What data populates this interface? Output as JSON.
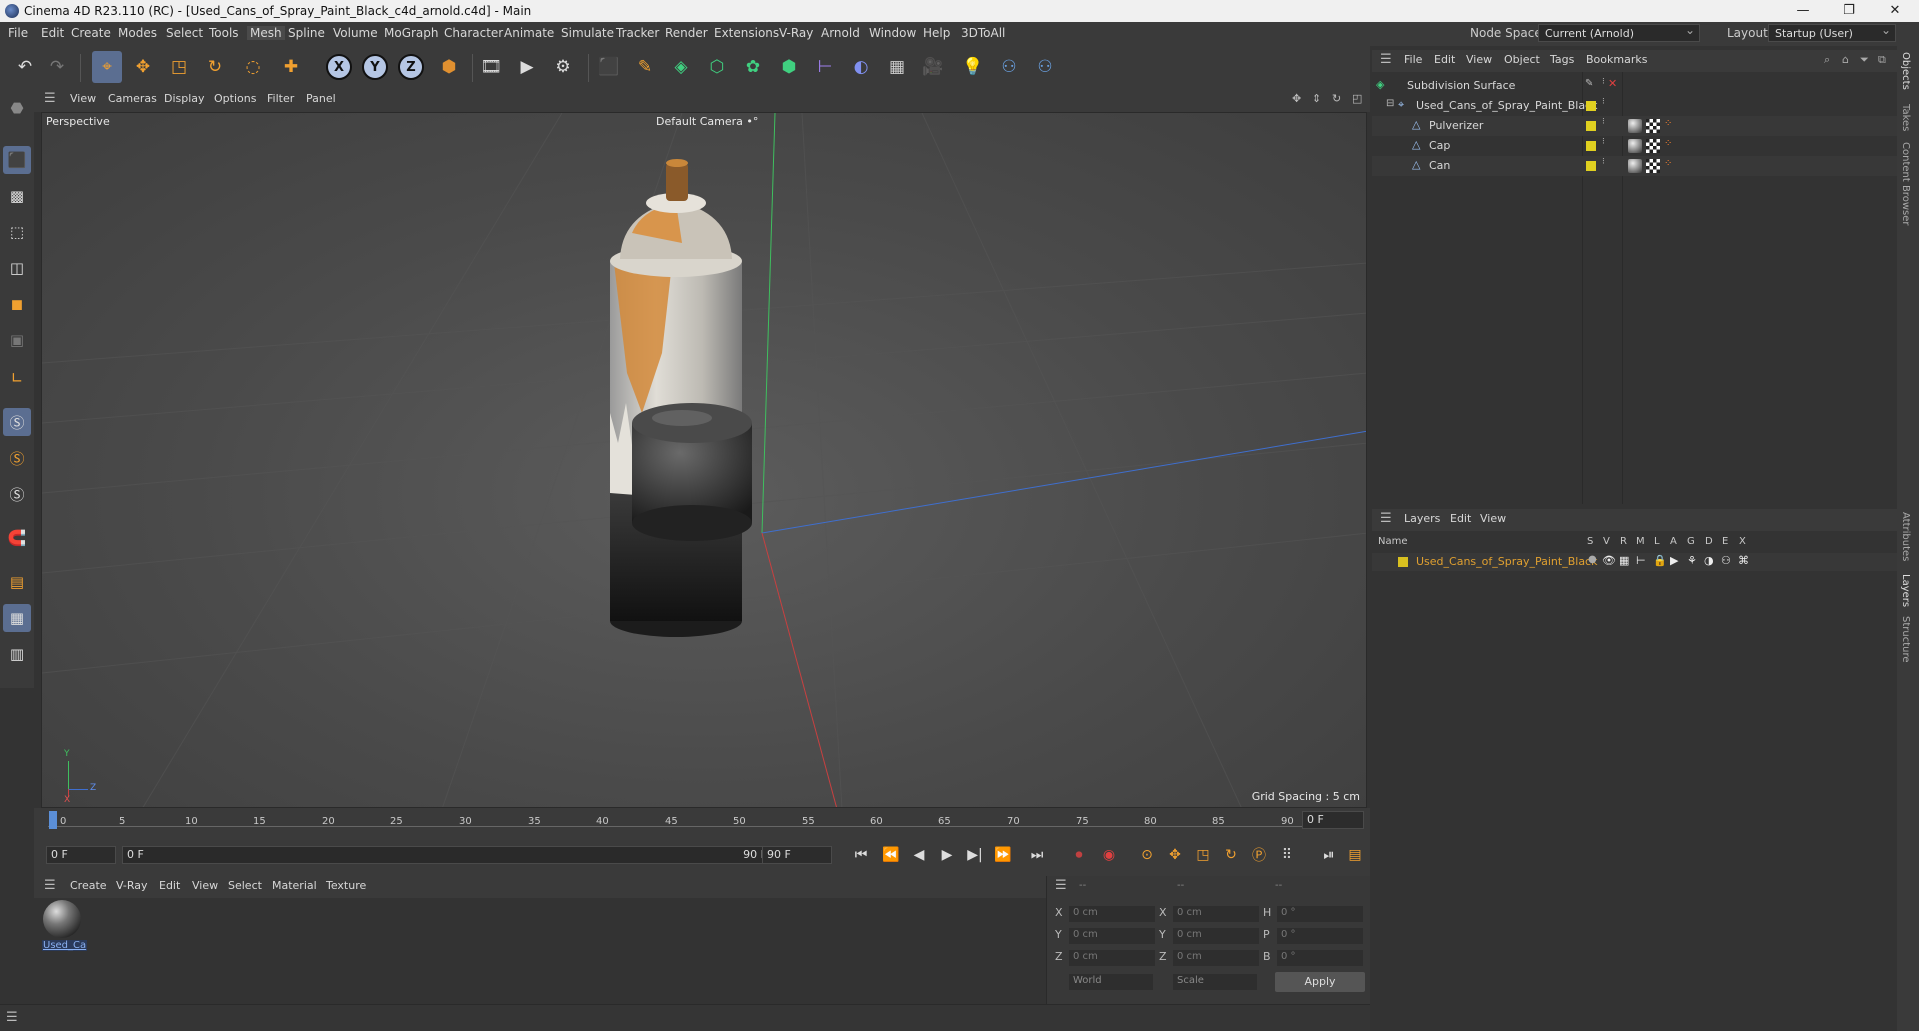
{
  "window": {
    "title": "Cinema 4D R23.110 (RC) - [Used_Cans_of_Spray_Paint_Black_c4d_arnold.c4d] - Main",
    "controls": [
      "—",
      "❐",
      "✕"
    ]
  },
  "menubar": {
    "items": [
      "File",
      "Edit",
      "Create",
      "Modes",
      "Select",
      "Tools",
      "Mesh",
      "Spline",
      "Volume",
      "MoGraph",
      "Character",
      "Animate",
      "Simulate",
      "Tracker",
      "Render",
      "Extensions",
      "V-Ray",
      "Arnold",
      "Window",
      "Help",
      "3DToAll"
    ],
    "active": "Mesh",
    "node_space_label": "Node Space:",
    "node_space_value": "Current (Arnold)",
    "layout_label": "Layout:",
    "layout_value": "Startup (User)"
  },
  "viewport": {
    "menu": [
      "View",
      "Cameras",
      "Display",
      "Options",
      "Filter",
      "Panel"
    ],
    "view_name": "Perspective",
    "camera": "Default Camera •°",
    "grid_spacing": "Grid Spacing : 5 cm",
    "axis_labels": {
      "y": "Y",
      "z": "Z",
      "x": "X"
    }
  },
  "timeline": {
    "ticks": [
      "0",
      "5",
      "10",
      "15",
      "20",
      "25",
      "30",
      "35",
      "40",
      "45",
      "50",
      "55",
      "60",
      "65",
      "70",
      "75",
      "80",
      "85",
      "90"
    ],
    "current_frame_field": "0 F",
    "start_field": "0 F",
    "range_start": "0 F",
    "range_end": "90 F",
    "end_field": "90 F"
  },
  "material_manager": {
    "menu": [
      "Create",
      "V-Ray",
      "Edit",
      "View",
      "Select",
      "Material",
      "Texture"
    ],
    "materials": [
      {
        "name": "Used_Ca"
      }
    ]
  },
  "coordinates": {
    "header": [
      "--",
      "--",
      "--"
    ],
    "rows": [
      {
        "a": "X",
        "av": "0 cm",
        "b": "X",
        "bv": "0 cm",
        "c": "H",
        "cv": "0 °"
      },
      {
        "a": "Y",
        "av": "0 cm",
        "b": "Y",
        "bv": "0 cm",
        "c": "P",
        "cv": "0 °"
      },
      {
        "a": "Z",
        "av": "0 cm",
        "b": "Z",
        "bv": "0 cm",
        "c": "B",
        "cv": "0 °"
      }
    ],
    "mode_world": "World",
    "mode_scale": "Scale",
    "apply": "Apply"
  },
  "object_manager": {
    "menu": [
      "File",
      "Edit",
      "View",
      "Object",
      "Tags",
      "Bookmarks"
    ],
    "objects": [
      {
        "name": "Subdivision Surface",
        "indent": 0
      },
      {
        "name": "Used_Cans_of_Spray_Paint_Black",
        "indent": 1
      },
      {
        "name": "Pulverizer",
        "indent": 2
      },
      {
        "name": "Cap",
        "indent": 2
      },
      {
        "name": "Can",
        "indent": 2
      }
    ]
  },
  "layer_manager": {
    "menu": [
      "Layers",
      "Edit",
      "View"
    ],
    "columns": [
      "Name",
      "S",
      "V",
      "R",
      "M",
      "L",
      "A",
      "G",
      "D",
      "E",
      "X"
    ],
    "layers": [
      {
        "name": "Used_Cans_of_Spray_Paint_Black",
        "color": "#d8c020"
      }
    ]
  },
  "right_tabs": [
    "Objects",
    "Takes",
    "Content Browser",
    "Attributes",
    "Layers",
    "Structure"
  ],
  "colors": {
    "accent": "#5b6e91",
    "layer_name": "#e0a030",
    "yellow_tag": "#e0d020"
  }
}
